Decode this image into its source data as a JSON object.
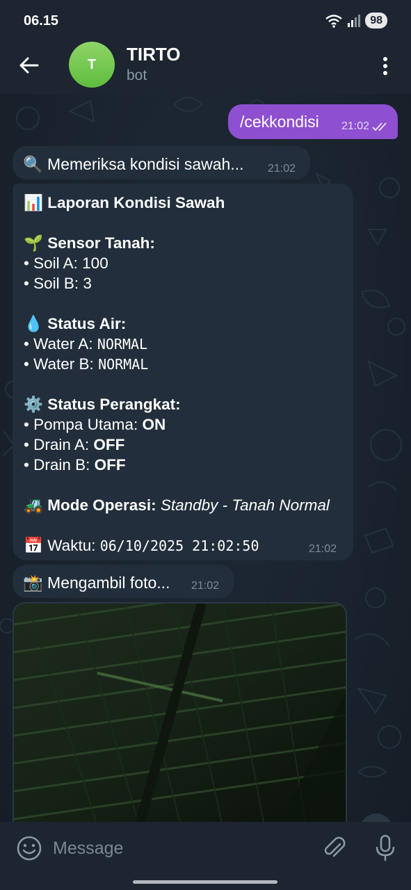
{
  "status_bar": {
    "time": "06.15",
    "battery": "98"
  },
  "header": {
    "avatar_letter": "T",
    "title": "TIRTO",
    "subtitle": "bot"
  },
  "messages": {
    "outgoing": {
      "text": "/cekkondisi",
      "time": "21:02"
    },
    "checking": {
      "icon": "🔍",
      "text": "Memeriksa kondisi sawah...",
      "time": "21:02"
    },
    "report": {
      "title_icon": "📊",
      "title": "Laporan Kondisi Sawah",
      "soil_icon": "🌱",
      "soil_heading": "Sensor Tanah:",
      "soil_a_label": "• Soil A: ",
      "soil_a_value": "100",
      "soil_b_label": "• Soil B: ",
      "soil_b_value": "3",
      "water_icon": "💧",
      "water_heading": "Status Air:",
      "water_a_label": "• Water A: ",
      "water_a_value": "NORMAL",
      "water_b_label": "• Water B: ",
      "water_b_value": "NORMAL",
      "device_icon": "⚙️",
      "device_heading": "Status Perangkat:",
      "pump_label": "• Pompa Utama: ",
      "pump_value": "ON",
      "drain_a_label": "• Drain A: ",
      "drain_a_value": "OFF",
      "drain_b_label": "• Drain B: ",
      "drain_b_value": "OFF",
      "mode_icon": "🚜",
      "mode_heading": "Mode Operasi:",
      "mode_value": "Standby - Tanah Normal",
      "time_icon": "📅",
      "time_label": "Waktu: ",
      "time_value": "06/10/2025 21:02:50",
      "time": "21:02"
    },
    "photo_status": {
      "icon": "📸",
      "text": "Mengambil foto...",
      "time": "21:02"
    }
  },
  "input": {
    "placeholder": "Message"
  },
  "colors": {
    "outgoing_bubble": "#8e4fd0",
    "incoming_bubble": "#222e3b",
    "header_bg": "#1c2530",
    "avatar": "#6cc64a"
  }
}
